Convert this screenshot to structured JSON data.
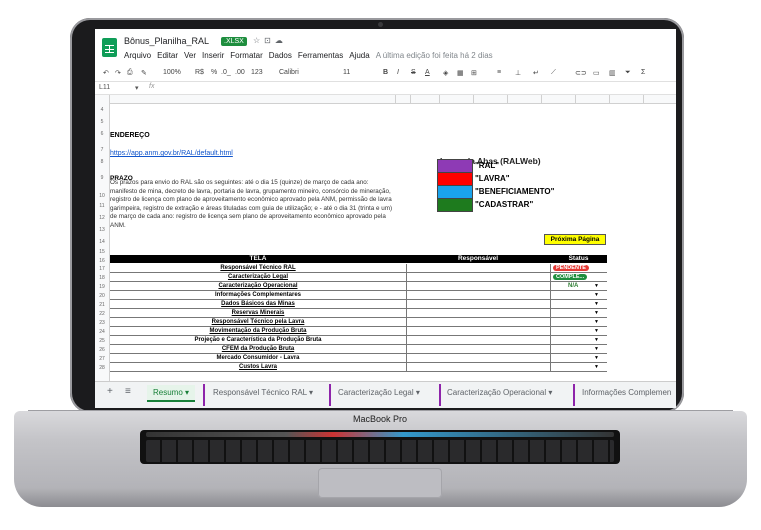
{
  "device": {
    "label": "MacBook Pro"
  },
  "app": {
    "doc_title": "Bônus_Planilha_RAL",
    "badge": ".XLSX",
    "menu": [
      "Arquivo",
      "Editar",
      "Ver",
      "Inserir",
      "Formatar",
      "Dados",
      "Ferramentas",
      "Ajuda"
    ],
    "last_edit": "A última edição foi feita há 2 dias"
  },
  "toolbar": {
    "zoom": "100%",
    "currency": "R$",
    "percent": "%",
    "dec1": ".0_",
    "dec2": ".00",
    "fmt": "123",
    "font": "Calibri",
    "size": "11",
    "bold": "B",
    "italic": "I",
    "strike": "S",
    "color": "A"
  },
  "formula": {
    "cell_ref": "L11",
    "fx": "fx"
  },
  "sheet": {
    "row_numbers": [
      "4",
      "5",
      "6",
      "7",
      "8",
      "9",
      "10",
      "11",
      "12",
      "13",
      "14",
      "15",
      "16",
      "17",
      "18",
      "19",
      "20",
      "21",
      "22",
      "23",
      "24",
      "25",
      "26",
      "27",
      "28"
    ],
    "endereco_label": "ENDEREÇO",
    "url": "https://app.anm.gov.br/RAL/default.html",
    "prazo_label": "PRAZO",
    "prazo_text": "Os prazos para envio do RAL são os seguintes:   até o dia 15 (quinze) de março de cada ano: manifesto de mina, decreto de lavra, portaria de lavra, grupamento mineiro, consórcio de mineração, registro de licença com plano de aproveitamento econômico aprovado pela ANM, permissão de lavra garimpeira, registro de extração e áreas tituladas com guia de utilização; e - até o dia 31 (trinta e um) de março de cada ano: registro de licença sem plano de aproveitamento econômico aprovado pela ANM.",
    "legend_title": "Legenda Abas (RALWeb)",
    "legend": [
      {
        "label": "\"RAL\"",
        "color": "#8e3ab5"
      },
      {
        "label": "\"LAVRA\"",
        "color": "#ff0000"
      },
      {
        "label": "\"BENEFICIAMENTO\"",
        "color": "#1aa3ec"
      },
      {
        "label": "\"CADASTRAR\"",
        "color": "#1e7b1e"
      }
    ],
    "next_page": "Próxima Página",
    "table": {
      "headers": [
        "TELA",
        "Responsável",
        "Status"
      ],
      "rows": [
        {
          "tela": "Responsável Técnico RAL",
          "status": "PENDENTE"
        },
        {
          "tela": "Caracterização Legal",
          "status": "COMPLE..."
        },
        {
          "tela": "Caracterização Operacional",
          "status": "N/A"
        },
        {
          "tela": "Informações Complementares",
          "status": ""
        },
        {
          "tela": "Dados Básicos das Minas",
          "status": ""
        },
        {
          "tela": "Reservas Minerais",
          "status": ""
        },
        {
          "tela": "Responsável Técnico pela Lavra",
          "status": ""
        },
        {
          "tela": "Movimentação da Produção Bruta",
          "status": ""
        },
        {
          "tela": "Projeção e Característica da Produção Bruta",
          "status": ""
        },
        {
          "tela": "CFEM da Produção Bruta",
          "status": ""
        },
        {
          "tela": "Mercado Consumidor - Lavra",
          "status": ""
        },
        {
          "tela": "Custos Lavra",
          "status": ""
        }
      ],
      "status_colors": {
        "pendente": "#e53935",
        "completo": "#1e8e3e"
      }
    }
  },
  "tabs": {
    "add": "+",
    "list": "≡",
    "items": [
      "Resumo",
      "Responsável Técnico RAL",
      "Caracterização Legal",
      "Caracterização Operacional",
      "Informações Complemen"
    ]
  }
}
